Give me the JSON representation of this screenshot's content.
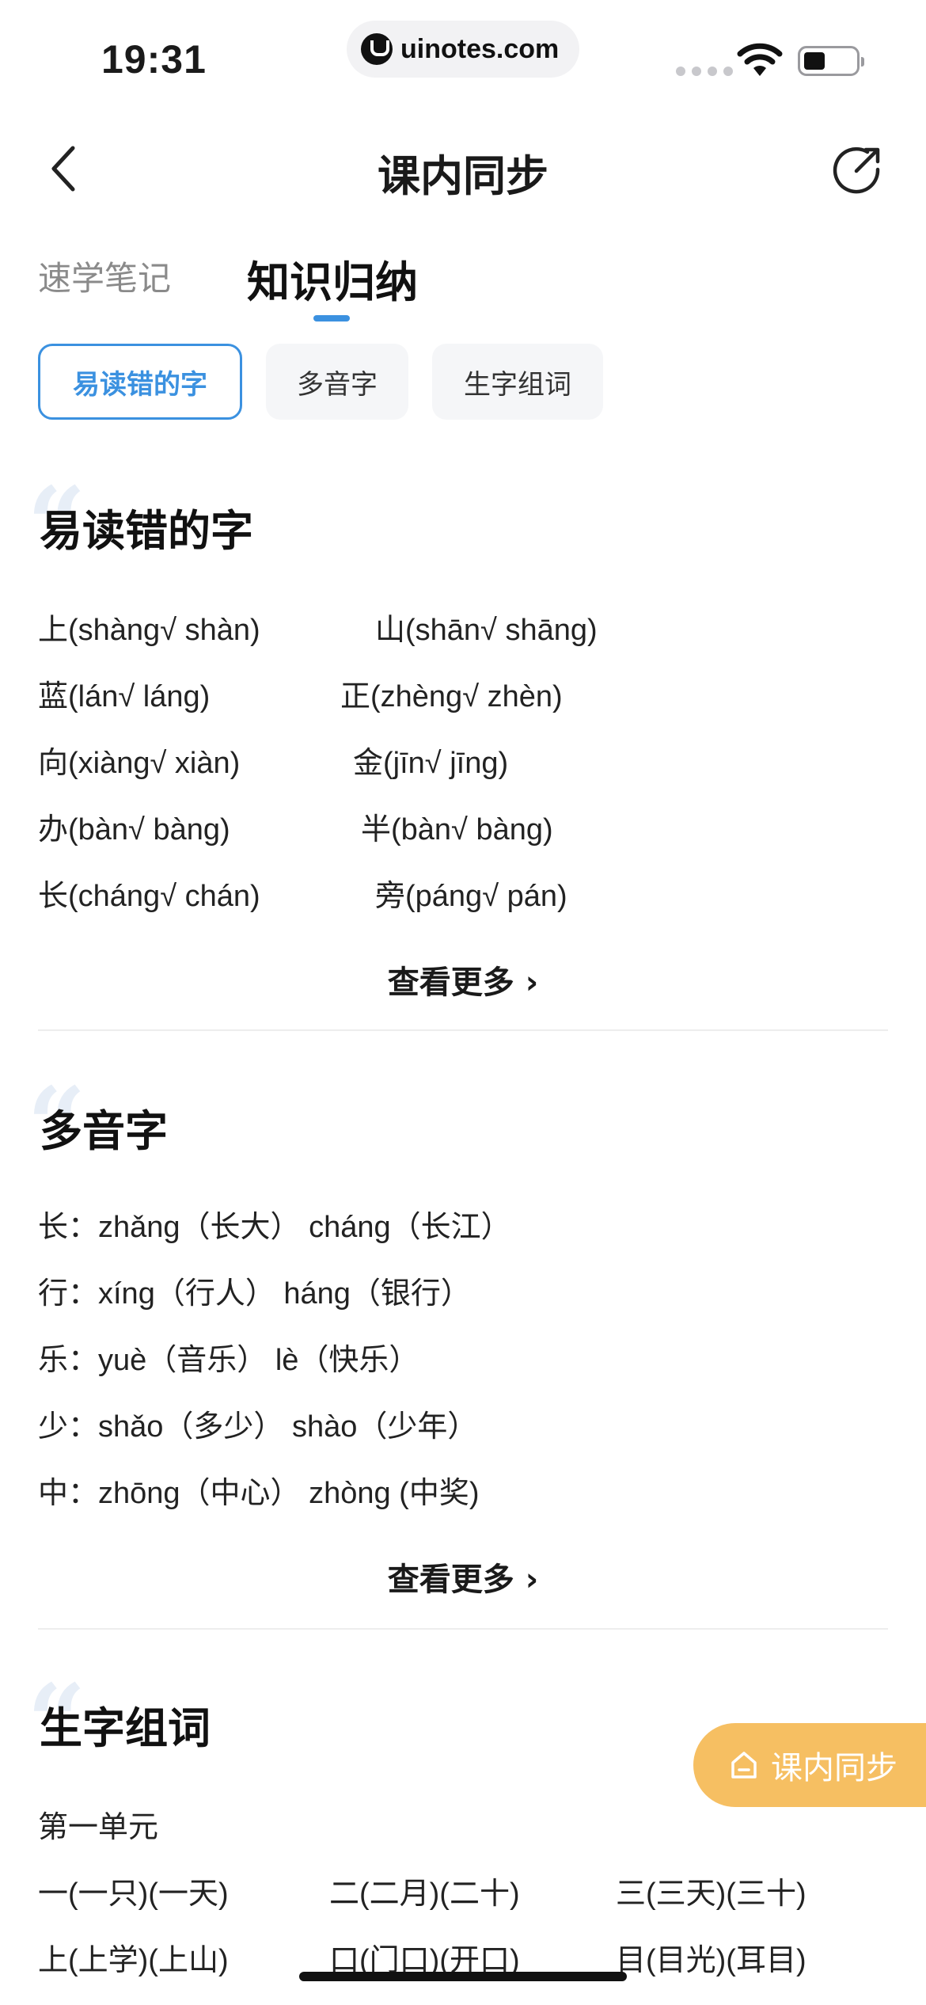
{
  "status_bar": {
    "time": "19:31",
    "url": "uinotes.com"
  },
  "nav": {
    "title": "课内同步",
    "back_icon": "chevron-left-icon",
    "share_icon": "share-icon"
  },
  "main_tabs": [
    {
      "label": "速学笔记",
      "active": false
    },
    {
      "label": "知识归纳",
      "active": true
    }
  ],
  "accent_color": "#3b91e0",
  "chips": [
    {
      "label": "易读错的字",
      "active": true
    },
    {
      "label": "多音字",
      "active": false
    },
    {
      "label": "生字组词",
      "active": false
    }
  ],
  "section_easy": {
    "title": "易读错的字",
    "rows": [
      [
        "上(shàng√ shàn)",
        "山(shān√ shāng)"
      ],
      [
        "蓝(lán√ láng)",
        "正(zhèng√ zhèn)"
      ],
      [
        "向(xiàng√ xiàn)",
        "金(jīn√ jīng)"
      ],
      [
        "办(bàn√ bàng)",
        "半(bàn√ bàng)"
      ],
      [
        "长(cháng√ chán)",
        "旁(páng√ pán)"
      ]
    ],
    "more": "查看更多 ›"
  },
  "section_poly": {
    "title": "多音字",
    "rows": [
      "长：zhǎng（长大） cháng（长江）",
      "行：xíng（行人） háng（银行）",
      "乐：yuè（音乐） lè（快乐）",
      "少：shǎo（多少） shào（少年）",
      "中：zhōng（中心） zhòng (中奖)"
    ],
    "more": "查看更多 ›"
  },
  "section_words": {
    "title": "生字组词",
    "unit": "第一单元",
    "rows": [
      [
        "一(一只)(一天)",
        "二(二月)(二十)",
        "三(三天)(三十)"
      ],
      [
        "上(上学)(上山)",
        "口(门口)(开口)",
        "目(目光)(耳目)"
      ]
    ]
  },
  "float_button": {
    "label": "课内同步",
    "color": "#f6bf62"
  }
}
